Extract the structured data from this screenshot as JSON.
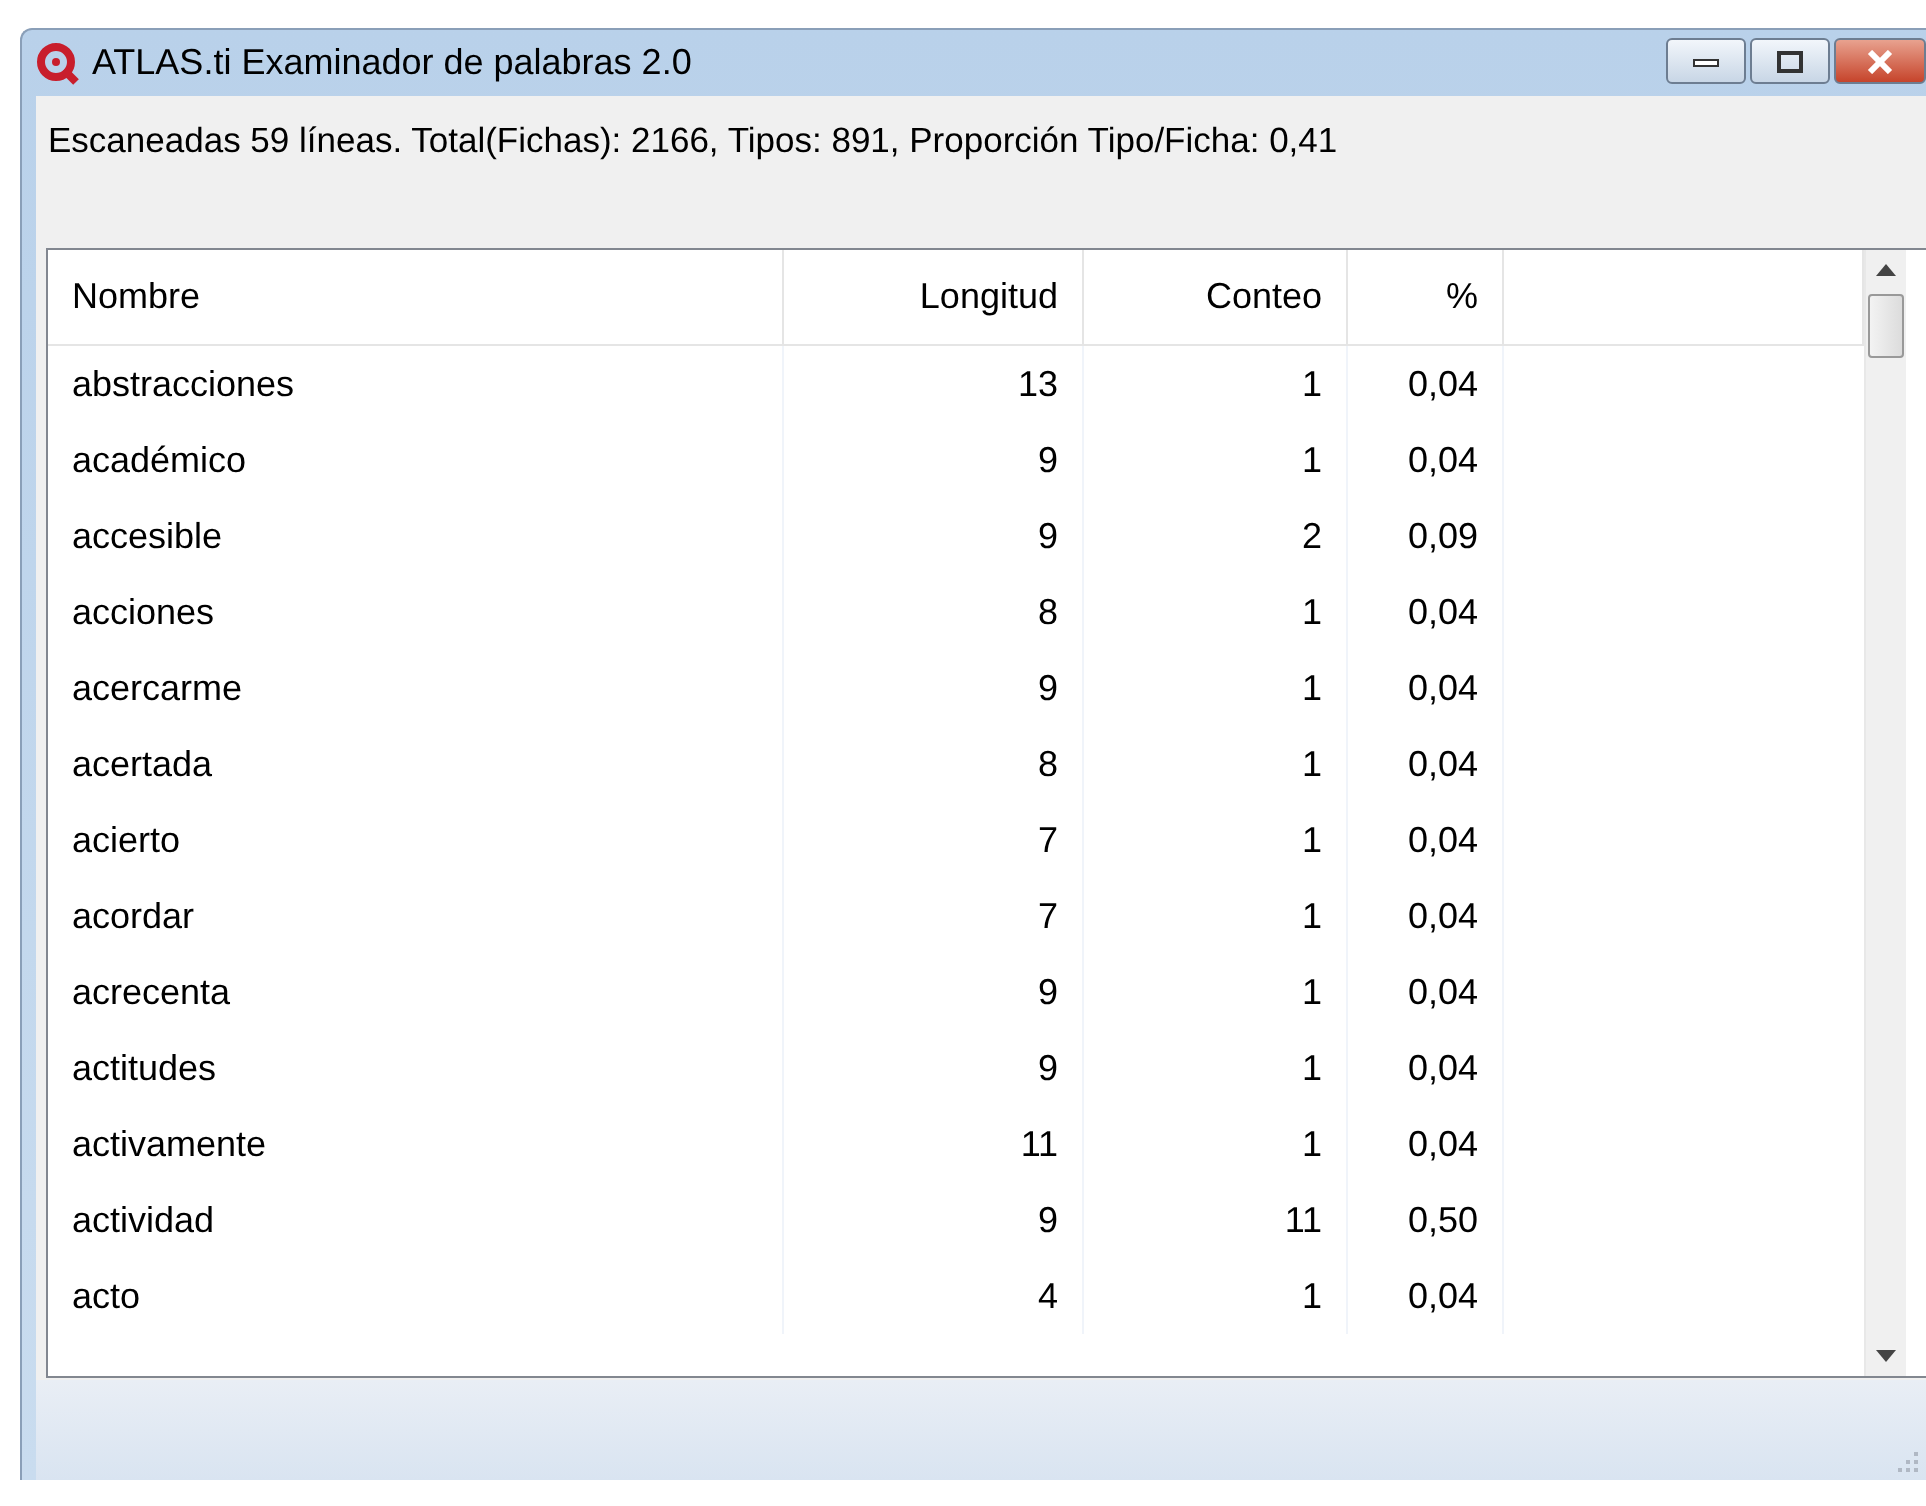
{
  "window": {
    "title": "ATLAS.ti Examinador de palabras 2.0"
  },
  "summary": "Escaneadas 59 líneas. Total(Fichas): 2166, Tipos: 891, Proporción Tipo/Ficha: 0,41",
  "table": {
    "columns": [
      "Nombre",
      "Longitud",
      "Conteo",
      "%"
    ],
    "rows": [
      [
        "abstracciones",
        "13",
        "1",
        "0,04"
      ],
      [
        "académico",
        "9",
        "1",
        "0,04"
      ],
      [
        "accesible",
        "9",
        "2",
        "0,09"
      ],
      [
        "acciones",
        "8",
        "1",
        "0,04"
      ],
      [
        "acercarme",
        "9",
        "1",
        "0,04"
      ],
      [
        "acertada",
        "8",
        "1",
        "0,04"
      ],
      [
        "acierto",
        "7",
        "1",
        "0,04"
      ],
      [
        "acordar",
        "7",
        "1",
        "0,04"
      ],
      [
        "acrecenta",
        "9",
        "1",
        "0,04"
      ],
      [
        "actitudes",
        "9",
        "1",
        "0,04"
      ],
      [
        "activamente",
        "11",
        "1",
        "0,04"
      ],
      [
        "actividad",
        "9",
        "11",
        "0,50"
      ],
      [
        "acto",
        "4",
        "1",
        "0,04"
      ]
    ]
  }
}
